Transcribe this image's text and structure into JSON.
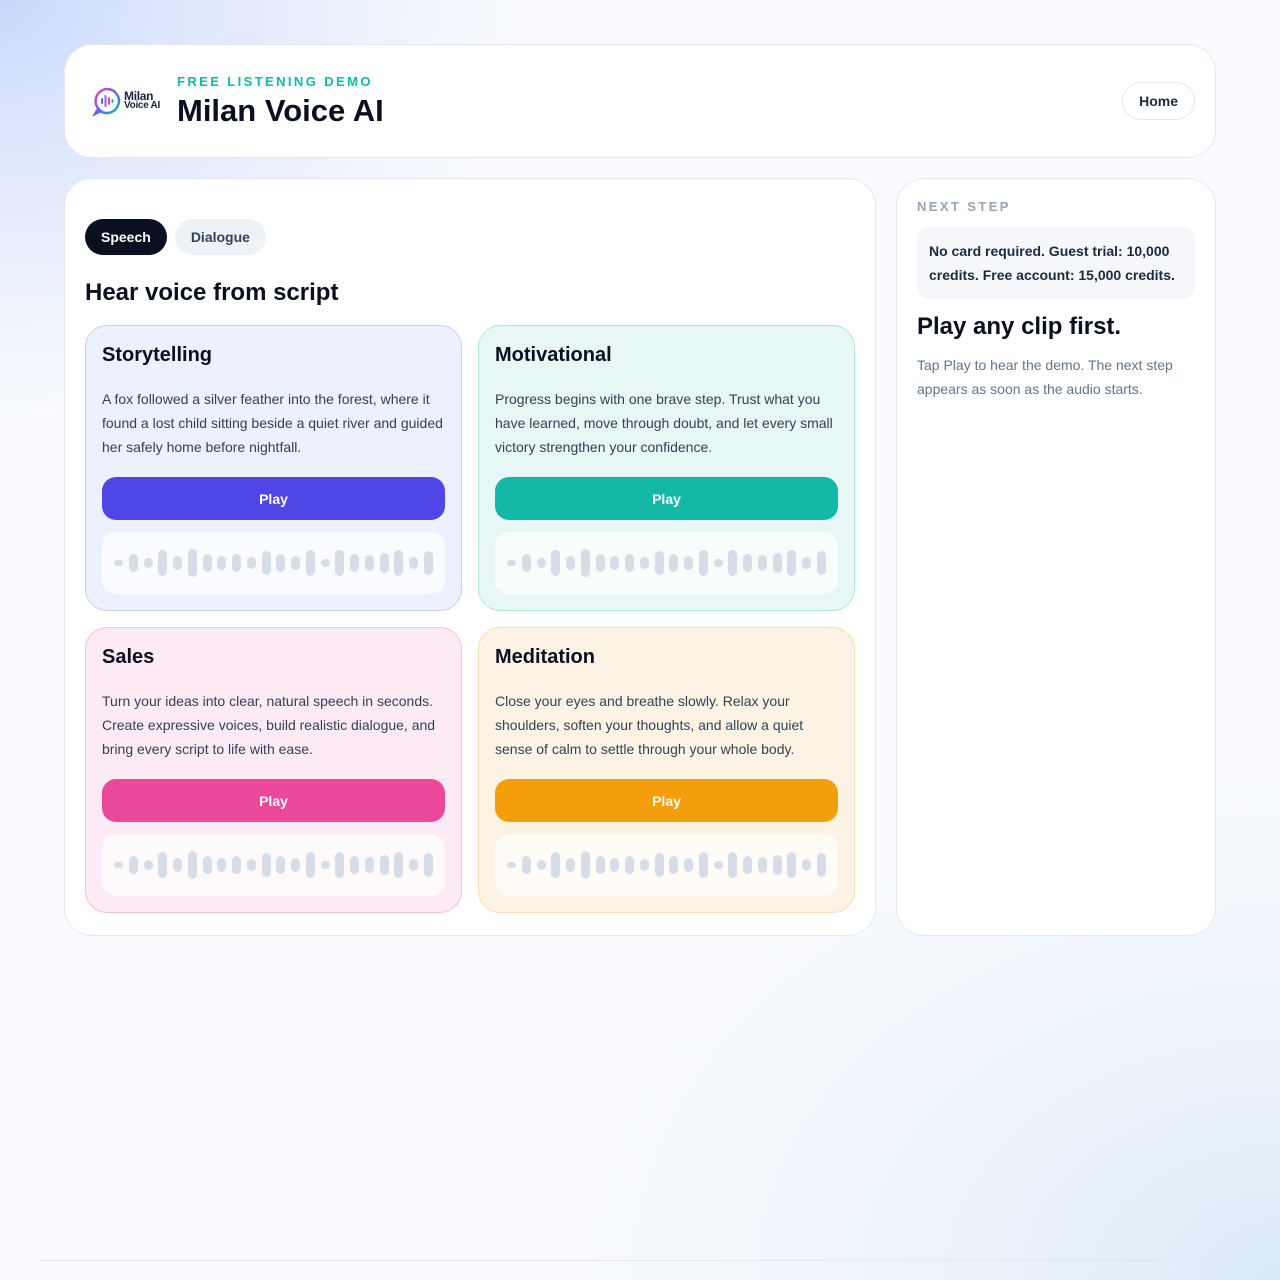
{
  "header": {
    "logo_line1": "Milan",
    "logo_line2": "Voice AI",
    "eyebrow": "FREE LISTENING DEMO",
    "title": "Milan Voice AI",
    "home_label": "Home"
  },
  "main": {
    "tabs": [
      {
        "label": "Speech",
        "active": true
      },
      {
        "label": "Dialogue",
        "active": false
      }
    ],
    "section_title": "Hear voice from script",
    "cards": [
      {
        "title": "Storytelling",
        "text": "A fox followed a silver feather into the forest, where it found a lost child sitting beside a quiet river and guided her safely home before nightfall.",
        "play_label": "Play",
        "accent": "#4f46e5",
        "bg": "#edf0fd",
        "border": "#c7cdf6"
      },
      {
        "title": "Motivational",
        "text": "Progress begins with one brave step. Trust what you have learned, move through doubt, and let every small victory strengthen your confidence.",
        "play_label": "Play",
        "accent": "#14b8a6",
        "bg": "#e7f7f5",
        "border": "#b3e6df"
      },
      {
        "title": "Sales",
        "text": "Turn your ideas into clear, natural speech in seconds. Create expressive voices, build realistic dialogue, and bring every script to life with ease.",
        "play_label": "Play",
        "accent": "#ec4899",
        "bg": "#fcebf4",
        "border": "#f5c0dc"
      },
      {
        "title": "Meditation",
        "text": "Close your eyes and breathe slowly. Relax your shoulders, soften your thoughts, and allow a quiet sense of calm to settle through your whole body.",
        "play_label": "Play",
        "accent": "#f59e0b",
        "bg": "#fdf3e4",
        "border": "#f8ddb0"
      }
    ]
  },
  "side": {
    "eyebrow": "NEXT STEP",
    "notice": "No card required. Guest trial: 10,000 credits. Free account: 15,000 credits.",
    "title": "Play any clip first.",
    "text": "Tap Play to hear the demo. The next step appears as soon as the audio starts."
  }
}
